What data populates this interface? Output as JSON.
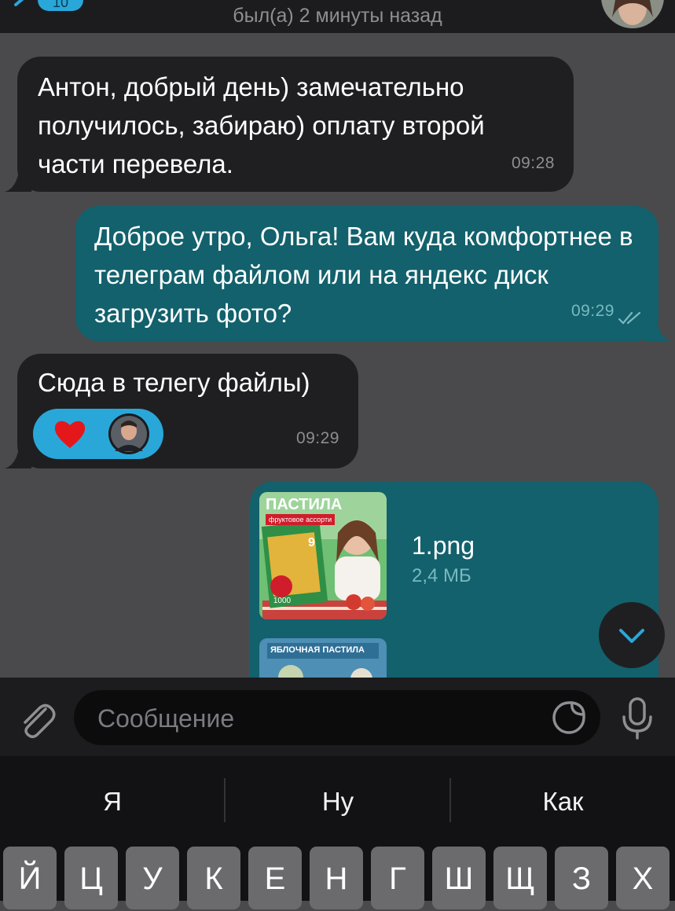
{
  "header": {
    "back_count": "10",
    "status": "был(а) 2 минуты назад"
  },
  "messages": [
    {
      "type": "incoming",
      "text": "Антон, добрый день) замечательно получилось, забираю) оплату второй части перевела.",
      "time": "09:28"
    },
    {
      "type": "outgoing",
      "text": "Доброе утро, Ольга! Вам куда комфортнее в телеграм файлом или на яндекс диск загрузить фото?",
      "time": "09:29",
      "status_icon": "double-check-icon"
    },
    {
      "type": "incoming",
      "text": "Сюда в телегу файлы)",
      "time": "09:29",
      "reactions": [
        "heart-icon",
        "avatar-anton"
      ]
    },
    {
      "type": "outgoing-file",
      "file": {
        "name": "1.png",
        "size": "2,4 МБ"
      },
      "thumb1": {
        "title": "ПАСТИЛА",
        "subtitle": "фруктовое ассорти",
        "count": "9",
        "badge": "1000"
      },
      "thumb2": {
        "title": "ЯБЛОЧНАЯ ПАСТИЛА"
      }
    }
  ],
  "composer": {
    "placeholder": "Сообщение",
    "attach_icon": "paperclip-icon",
    "sticker_icon": "sticker-icon",
    "mic_icon": "microphone-icon"
  },
  "keyboard": {
    "suggestions": [
      "Я",
      "Ну",
      "Как"
    ],
    "keys": [
      "Й",
      "Ц",
      "У",
      "К",
      "Е",
      "Н",
      "Г",
      "Ш",
      "Щ",
      "З",
      "Х"
    ]
  },
  "colors": {
    "background": "#4a4a4c",
    "incoming_bubble": "#1f1f21",
    "outgoing_bubble": "#12616c",
    "accent": "#2aa7d9"
  }
}
